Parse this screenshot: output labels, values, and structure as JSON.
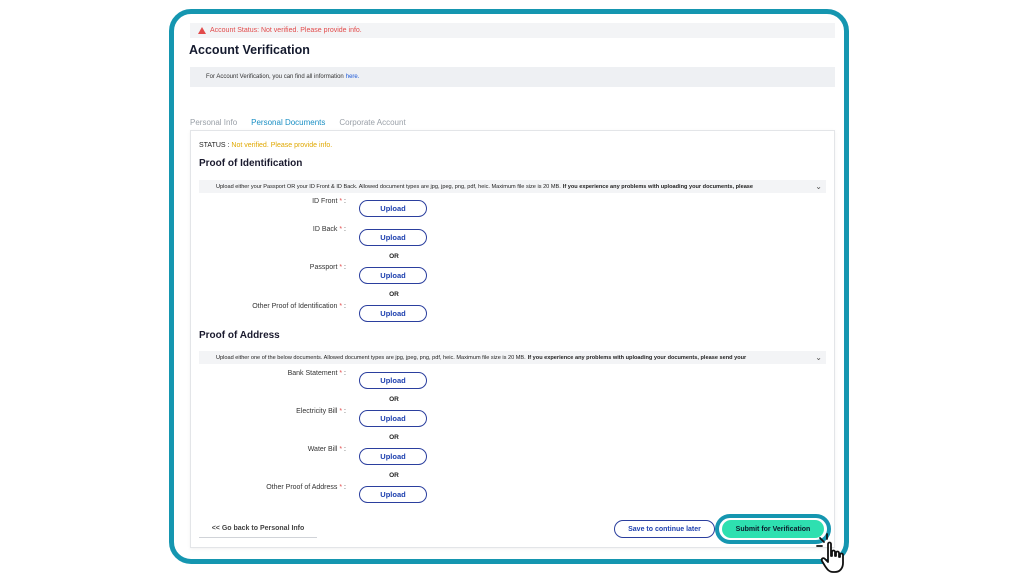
{
  "alert": {
    "icon": "warning-icon",
    "text": "Account Status: Not verified. Please provide info."
  },
  "page": {
    "title": "Account Verification"
  },
  "info": {
    "text": "For Account Verification, you can find all information",
    "link": "here."
  },
  "tabs": [
    {
      "label": "Personal Info",
      "active": false
    },
    {
      "label": "Personal Documents",
      "active": true
    },
    {
      "label": "Corporate Account",
      "active": false
    }
  ],
  "status": {
    "label": "STATUS :",
    "value": "Not verified. Please provide info."
  },
  "identification": {
    "title": "Proof of Identification",
    "notice": "Upload either your Passport OR your ID Front & ID Back. Allowed document types are jpg, jpeg, png, pdf, heic. Maximum file size is 20 MB.",
    "notice_bold": "If you experience any problems with uploading your documents, please",
    "fields": [
      {
        "label": "ID Front",
        "button": "Upload"
      },
      {
        "label": "ID Back",
        "button": "Upload"
      },
      {
        "label": "Passport",
        "button": "Upload"
      },
      {
        "label": "Other Proof of Identification",
        "button": "Upload"
      }
    ]
  },
  "address": {
    "title": "Proof of Address",
    "notice": "Upload either one of the below documents. Allowed document types are jpg, jpeg, png, pdf, heic. Maximum file size is 20 MB.",
    "notice_bold": "If you experience any problems with uploading your documents, please send your",
    "fields": [
      {
        "label": "Bank Statement",
        "button": "Upload"
      },
      {
        "label": "Electricity Bill",
        "button": "Upload"
      },
      {
        "label": "Water Bill",
        "button": "Upload"
      },
      {
        "label": "Other Proof of Address",
        "button": "Upload"
      }
    ]
  },
  "labels": {
    "required": "*",
    "colon": ":",
    "or": "OR"
  },
  "icons": {
    "chevron": "chevron-down-icon",
    "cursor": "pointer-hand-icon"
  },
  "actions": {
    "back": "<< Go back to Personal Info",
    "save": "Save to continue later",
    "submit": "Submit for Verification"
  },
  "colors": {
    "accent": "#1596b0",
    "submit": "#2ee0b0",
    "link": "#1a56d6",
    "error": "#e24b4b",
    "status": "#e0a800"
  }
}
